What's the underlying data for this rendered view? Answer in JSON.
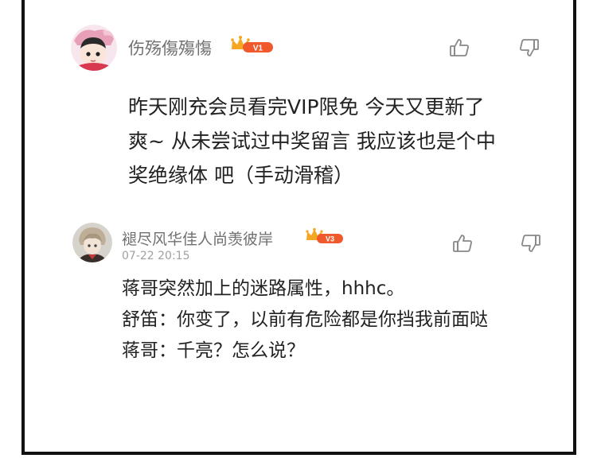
{
  "comments": [
    {
      "username": "伤殇傷殤慯",
      "vip_level": "V1",
      "body": "昨天刚充会员看完VIP限免  今天又更新了\n爽~  从未尝试过中奖留言  我应该也是个中\n奖绝缘体 吧（手动滑稽）",
      "avatar_icon": "anime-character-avatar",
      "like_icon": "thumbs-up-icon",
      "dislike_icon": "thumbs-down-icon"
    },
    {
      "username": "褪尽风华佳人尚羡彼岸",
      "vip_level": "V3",
      "timestamp": "07-22 20:15",
      "body": "蒋哥突然加上的迷路属性，hhhc。\n舒笛：你变了，以前有危险都是你挡我前面哒\n蒋哥：千亮？怎么说？",
      "avatar_icon": "anime-character-avatar",
      "like_icon": "thumbs-up-icon",
      "dislike_icon": "thumbs-down-icon"
    }
  ],
  "colors": {
    "username": "#707070",
    "body_text": "#222222",
    "timestamp": "#a0a0a0",
    "vip_badge": "#f5a623",
    "vip_text": "#ffffff",
    "icon": "#888888",
    "frame": "#111111"
  }
}
